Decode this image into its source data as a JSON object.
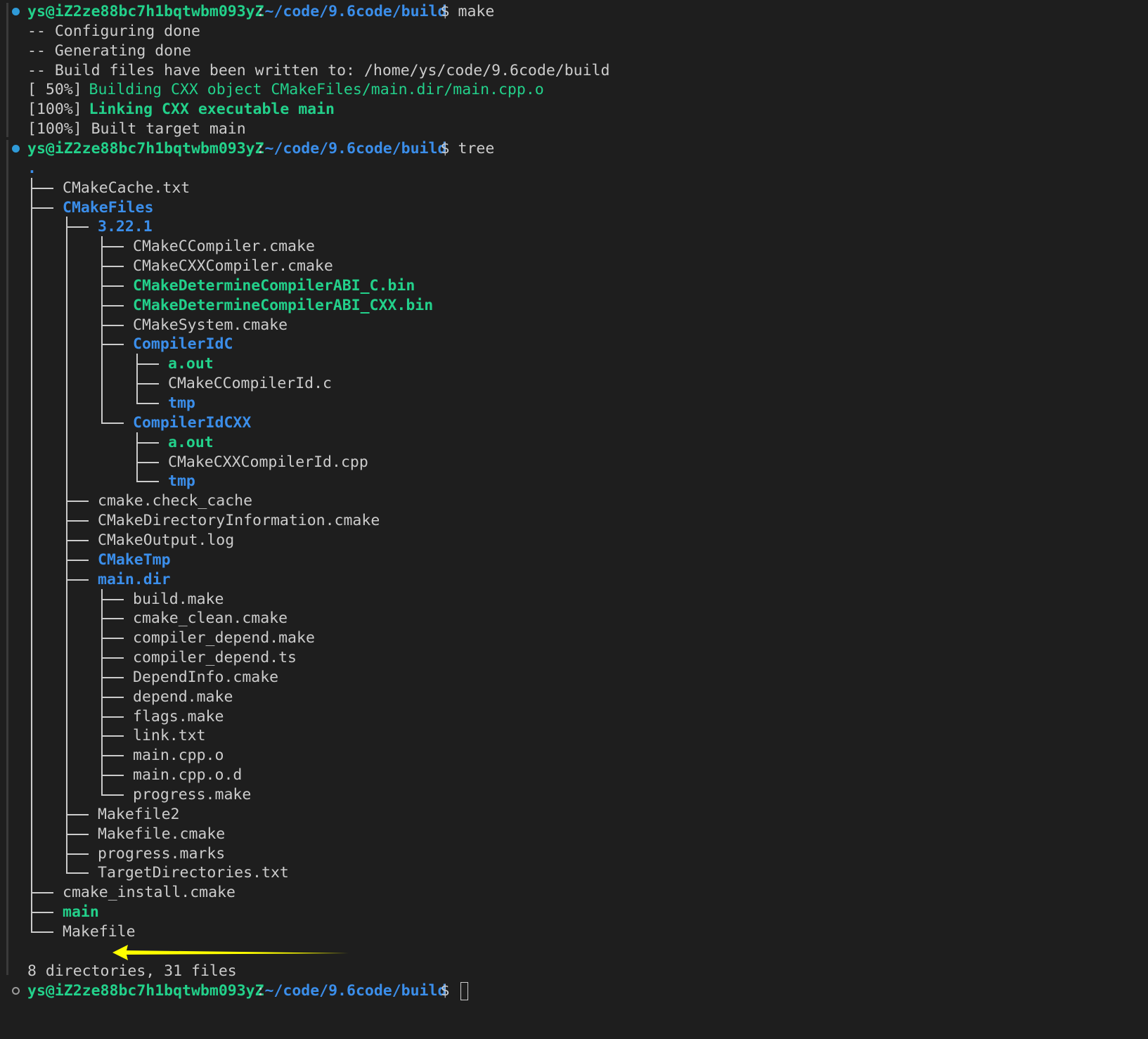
{
  "terminal": {
    "prompt": {
      "user_host": "ys@iZ2ze88bc7h1bqtwbm093yZ",
      "separator": ":",
      "cwd": "~/code/9.6code/build",
      "symbol": "$"
    },
    "commands": [
      "make",
      "tree",
      ""
    ],
    "make_output": [
      {
        "text": "-- Configuring done",
        "style": "plain"
      },
      {
        "text": "-- Generating done",
        "style": "plain"
      },
      {
        "text": "-- Build files have been written to: /home/ys/code/9.6code/build",
        "style": "plain"
      },
      {
        "parts": [
          {
            "text": "[ 50%] ",
            "style": "plain"
          },
          {
            "text": "Building CXX object CMakeFiles/main.dir/main.cpp.o",
            "style": "green"
          }
        ]
      },
      {
        "parts": [
          {
            "text": "[100%] ",
            "style": "plain"
          },
          {
            "text": "Linking CXX executable main",
            "style": "greenb"
          }
        ]
      },
      {
        "text": "[100%] Built target main",
        "style": "plain"
      }
    ],
    "tree_root": ".",
    "tree": [
      {
        "name": "CMakeCache.txt",
        "kind": "file"
      },
      {
        "name": "CMakeFiles",
        "kind": "dir",
        "children": [
          {
            "name": "3.22.1",
            "kind": "dir",
            "children": [
              {
                "name": "CMakeCCompiler.cmake",
                "kind": "file"
              },
              {
                "name": "CMakeCXXCompiler.cmake",
                "kind": "file"
              },
              {
                "name": "CMakeDetermineCompilerABI_C.bin",
                "kind": "exe"
              },
              {
                "name": "CMakeDetermineCompilerABI_CXX.bin",
                "kind": "exe"
              },
              {
                "name": "CMakeSystem.cmake",
                "kind": "file"
              },
              {
                "name": "CompilerIdC",
                "kind": "dir",
                "children": [
                  {
                    "name": "a.out",
                    "kind": "exe"
                  },
                  {
                    "name": "CMakeCCompilerId.c",
                    "kind": "file"
                  },
                  {
                    "name": "tmp",
                    "kind": "dir"
                  }
                ]
              },
              {
                "name": "CompilerIdCXX",
                "kind": "dir",
                "children": [
                  {
                    "name": "a.out",
                    "kind": "exe"
                  },
                  {
                    "name": "CMakeCXXCompilerId.cpp",
                    "kind": "file"
                  },
                  {
                    "name": "tmp",
                    "kind": "dir"
                  }
                ]
              }
            ]
          },
          {
            "name": "cmake.check_cache",
            "kind": "file"
          },
          {
            "name": "CMakeDirectoryInformation.cmake",
            "kind": "file"
          },
          {
            "name": "CMakeOutput.log",
            "kind": "file"
          },
          {
            "name": "CMakeTmp",
            "kind": "dir"
          },
          {
            "name": "main.dir",
            "kind": "dir",
            "children": [
              {
                "name": "build.make",
                "kind": "file"
              },
              {
                "name": "cmake_clean.cmake",
                "kind": "file"
              },
              {
                "name": "compiler_depend.make",
                "kind": "file"
              },
              {
                "name": "compiler_depend.ts",
                "kind": "file"
              },
              {
                "name": "DependInfo.cmake",
                "kind": "file"
              },
              {
                "name": "depend.make",
                "kind": "file"
              },
              {
                "name": "flags.make",
                "kind": "file"
              },
              {
                "name": "link.txt",
                "kind": "file"
              },
              {
                "name": "main.cpp.o",
                "kind": "file"
              },
              {
                "name": "main.cpp.o.d",
                "kind": "file"
              },
              {
                "name": "progress.make",
                "kind": "file"
              }
            ]
          },
          {
            "name": "Makefile2",
            "kind": "file"
          },
          {
            "name": "Makefile.cmake",
            "kind": "file"
          },
          {
            "name": "progress.marks",
            "kind": "file"
          },
          {
            "name": "TargetDirectories.txt",
            "kind": "file"
          }
        ]
      },
      {
        "name": "cmake_install.cmake",
        "kind": "file"
      },
      {
        "name": "main",
        "kind": "exe",
        "highlighted": true
      },
      {
        "name": "Makefile",
        "kind": "file"
      }
    ],
    "summary": "8 directories, 31 files",
    "colors": {
      "background": "#1e1e1e",
      "text": "#cccccc",
      "user_host": "#23d18b",
      "path": "#3b8eea",
      "directory": "#3b8eea",
      "executable": "#23d18b",
      "annotation_arrow": "#ffff00",
      "success_dot": "#2f9ad8"
    },
    "annotation": {
      "type": "arrow",
      "color": "#ffff00",
      "points_to": "main"
    }
  }
}
